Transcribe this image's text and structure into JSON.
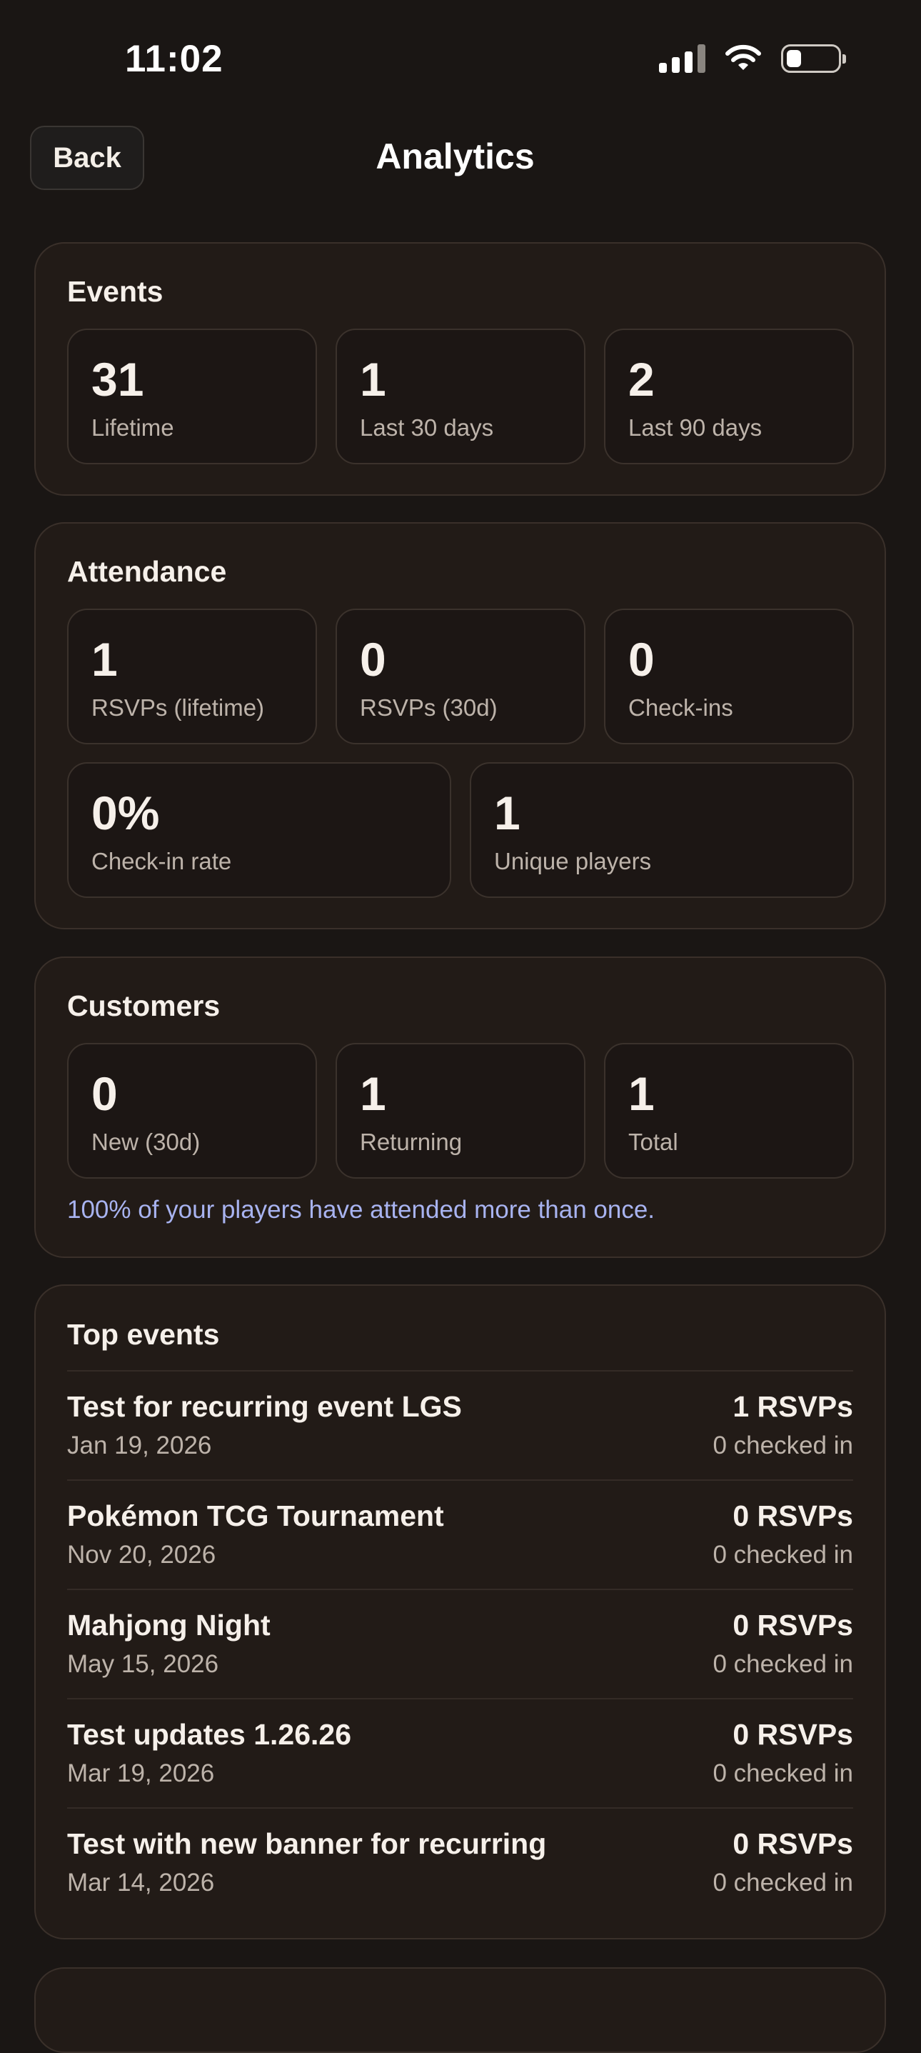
{
  "status_bar": {
    "time": "11:02",
    "icons": [
      "signal-icon",
      "wifi-icon",
      "battery-icon"
    ]
  },
  "header": {
    "back_label": "Back",
    "title": "Analytics"
  },
  "events": {
    "title": "Events",
    "stats": [
      {
        "value": "31",
        "label": "Lifetime"
      },
      {
        "value": "1",
        "label": "Last 30 days"
      },
      {
        "value": "2",
        "label": "Last 90 days"
      }
    ]
  },
  "attendance": {
    "title": "Attendance",
    "stats": [
      {
        "value": "1",
        "label": "RSVPs (lifetime)"
      },
      {
        "value": "0",
        "label": "RSVPs (30d)"
      },
      {
        "value": "0",
        "label": "Check-ins"
      },
      {
        "value": "0%",
        "label": "Check-in rate"
      },
      {
        "value": "1",
        "label": "Unique players"
      }
    ]
  },
  "customers": {
    "title": "Customers",
    "stats": [
      {
        "value": "0",
        "label": "New (30d)"
      },
      {
        "value": "1",
        "label": "Returning"
      },
      {
        "value": "1",
        "label": "Total"
      }
    ],
    "note": "100% of your players have attended more than once."
  },
  "top_events": {
    "title": "Top events",
    "items": [
      {
        "name": "Test for recurring event LGS",
        "date": "Jan 19, 2026",
        "rsvps": "1 RSVPs",
        "checked": "0 checked in"
      },
      {
        "name": "Pokémon TCG Tournament",
        "date": "Nov 20, 2026",
        "rsvps": "0 RSVPs",
        "checked": "0 checked in"
      },
      {
        "name": "Mahjong Night",
        "date": "May 15, 2026",
        "rsvps": "0 RSVPs",
        "checked": "0 checked in"
      },
      {
        "name": "Test updates 1.26.26",
        "date": "Mar 19, 2026",
        "rsvps": "0 RSVPs",
        "checked": "0 checked in"
      },
      {
        "name": "Test with new banner for recurring",
        "date": "Mar 14, 2026",
        "rsvps": "0 RSVPs",
        "checked": "0 checked in"
      }
    ]
  },
  "colors": {
    "background": "#1a1614",
    "card": "#221b17",
    "accent_note": "#a8b3f0"
  }
}
